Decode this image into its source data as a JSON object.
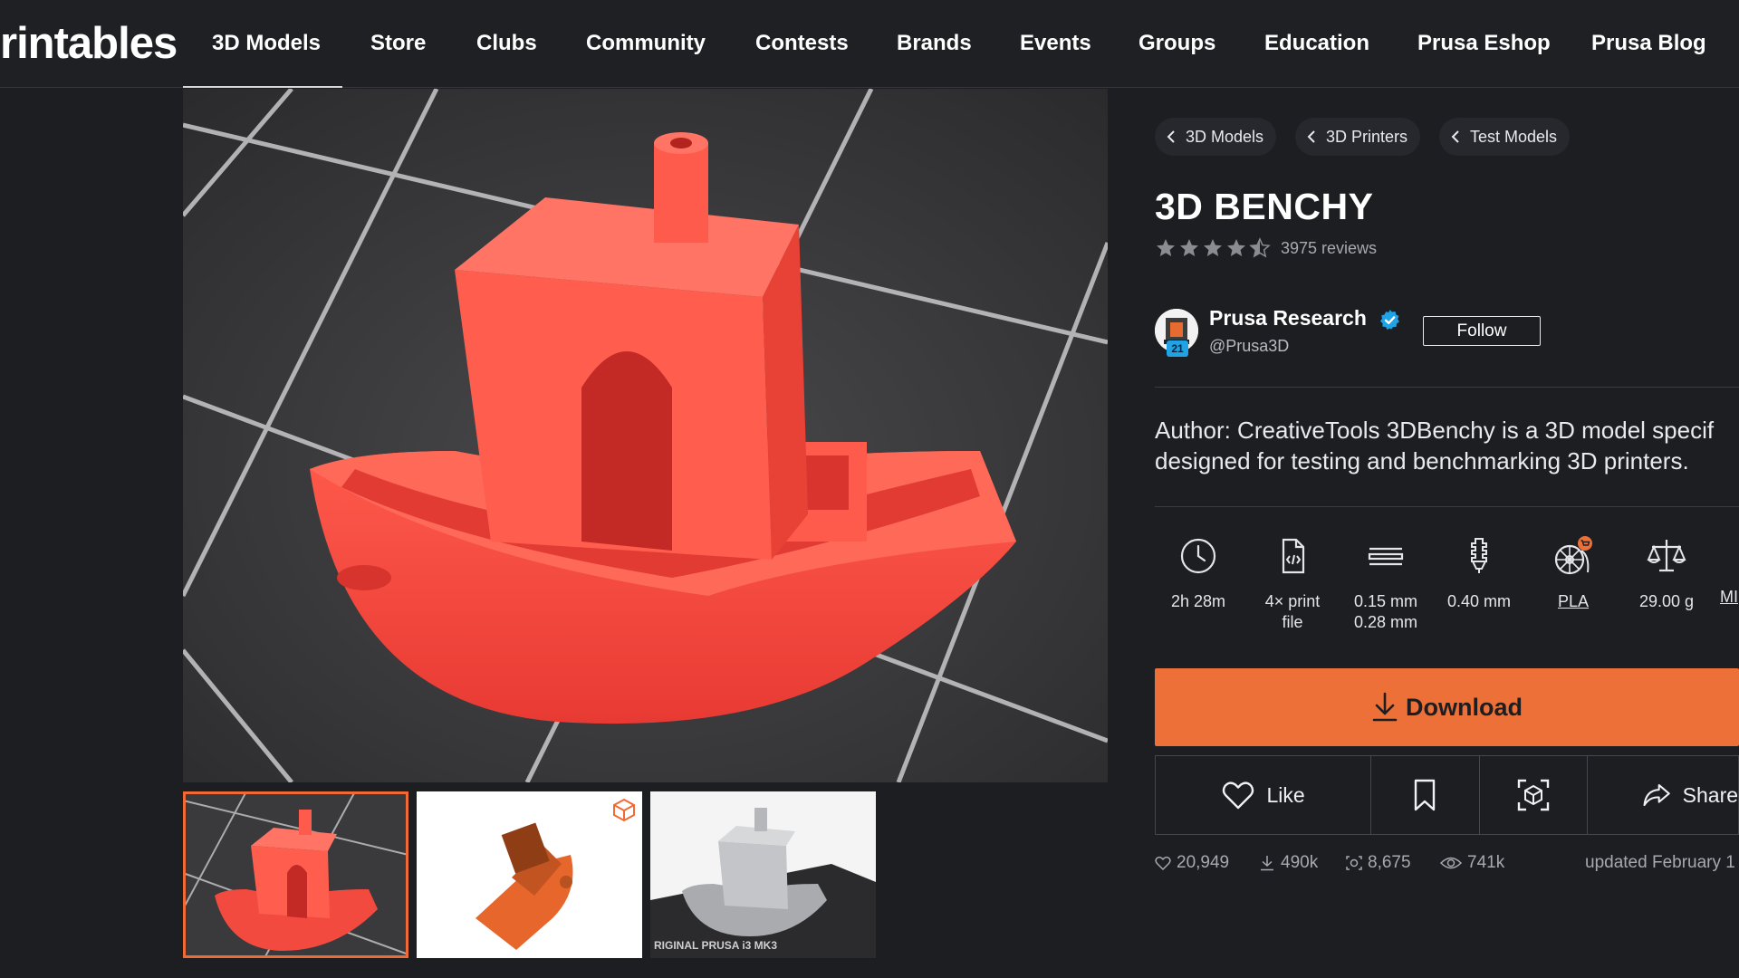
{
  "brand": {
    "logo_text": "rintables"
  },
  "nav": {
    "items": [
      {
        "label": "3D Models"
      },
      {
        "label": "Store"
      },
      {
        "label": "Clubs"
      },
      {
        "label": "Community"
      },
      {
        "label": "Contests"
      },
      {
        "label": "Brands"
      },
      {
        "label": "Events"
      },
      {
        "label": "Groups"
      },
      {
        "label": "Education"
      },
      {
        "label": "Prusa Eshop"
      },
      {
        "label": "Prusa Blog"
      }
    ]
  },
  "breadcrumbs": [
    {
      "label": "3D Models"
    },
    {
      "label": "3D Printers"
    },
    {
      "label": "Test Models"
    }
  ],
  "model": {
    "title": "3D BENCHY",
    "rating": 4.5,
    "reviews": "3975 reviews",
    "description": "Author: CreativeTools 3DBenchy is a 3D model specif\ndesigned for testing and benchmarking 3D printers."
  },
  "author": {
    "name": "Prusa Research",
    "handle": "@Prusa3D",
    "badge": "21",
    "follow_label": "Follow"
  },
  "specs": [
    {
      "icon": "clock-icon",
      "label": "2h 28m"
    },
    {
      "icon": "print-file-icon",
      "label": "4× print\nfile"
    },
    {
      "icon": "layer-height-icon",
      "label": "0.15 mm\n0.28 mm"
    },
    {
      "icon": "nozzle-icon",
      "label": "0.40 mm"
    },
    {
      "icon": "filament-spool-icon",
      "label": "PLA",
      "link": true
    },
    {
      "icon": "scale-icon",
      "label": "29.00 g"
    },
    {
      "icon": "printer-icon",
      "label": "MI",
      "link": true
    }
  ],
  "actions": {
    "download_label": "Download",
    "like_label": "Like",
    "share_label": "Share"
  },
  "stats": {
    "likes": "20,949",
    "downloads": "490k",
    "makes": "8,675",
    "views": "741k",
    "updated": "updated February 1"
  },
  "colors": {
    "accent": "#ec7037",
    "verified": "#1fa3e5",
    "benchy_red": "#f2463e"
  }
}
